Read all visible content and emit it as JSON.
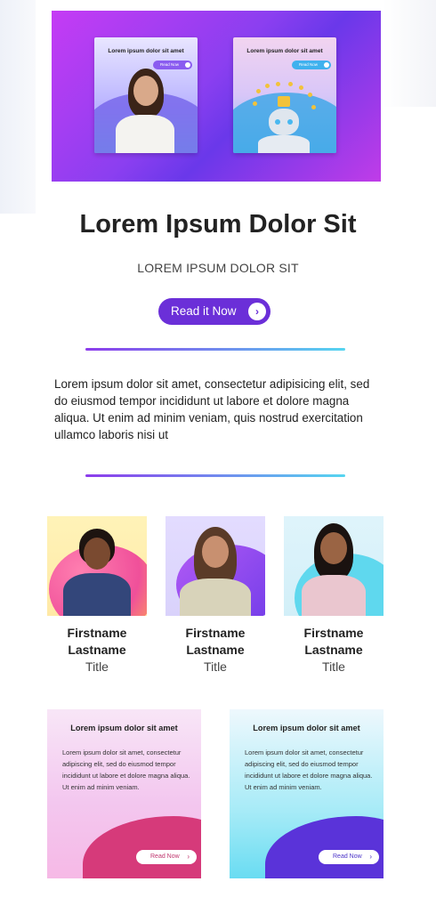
{
  "hero": {
    "cards": [
      {
        "title": "Lorem ipsum dolor sit amet",
        "button": "Read Now"
      },
      {
        "title": "Lorem ipsum dolor sit amet",
        "button": "Read Now"
      }
    ]
  },
  "headline": "Lorem Ipsum Dolor Sit",
  "subheadline": "LOREM IPSUM DOLOR SIT",
  "cta": {
    "label": "Read it Now",
    "icon": "chevron-right-icon"
  },
  "body_text": "Lorem ipsum dolor sit amet, consectetur adipisicing elit, sed do eiusmod tempor incididunt ut labore et dolore magna aliqua. Ut enim ad minim veniam, quis nostrud exercitation ullamco laboris nisi ut",
  "team": [
    {
      "firstname": "Firstname",
      "lastname": "Lastname",
      "title": "Title"
    },
    {
      "firstname": "Firstname",
      "lastname": "Lastname",
      "title": "Title"
    },
    {
      "firstname": "Firstname",
      "lastname": "Lastname",
      "title": "Title"
    }
  ],
  "cards": [
    {
      "title": "Lorem ipsum dolor sit amet",
      "body": "Lorem ipsum dolor sit amet, consectetur adipiscing elit, sed do eiusmod tempor incididunt ut labore et dolore magna aliqua. Ut enim ad minim veniam.",
      "button": "Read Now"
    },
    {
      "title": "Lorem ipsum dolor sit amet",
      "body": "Lorem ipsum dolor sit amet, consectetur adipiscing elit, sed do eiusmod tempor incididunt ut labore et dolore magna aliqua. Ut enim ad minim veniam.",
      "button": "Read Now"
    }
  ],
  "colors": {
    "accent": "#6b2fd8",
    "gradient_start": "#8d3cec",
    "gradient_end": "#56d5f0"
  }
}
